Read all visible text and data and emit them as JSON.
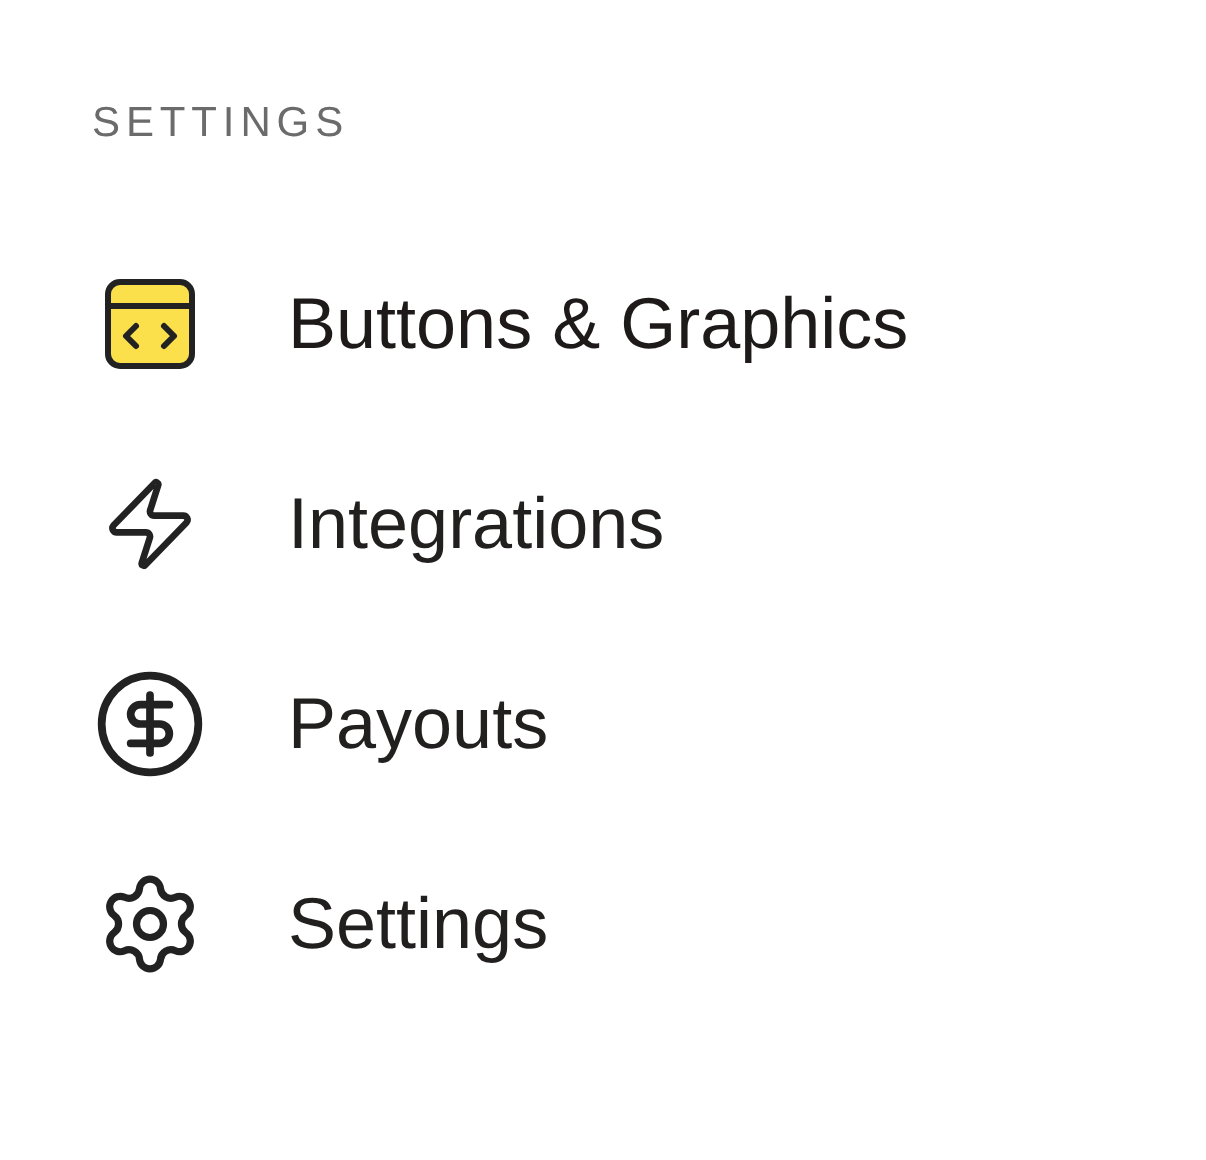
{
  "section_heading": "SETTINGS",
  "items": [
    {
      "kind": "code-window",
      "label": "Buttons & Graphics",
      "selected": true
    },
    {
      "kind": "bolt",
      "label": "Integrations",
      "selected": false
    },
    {
      "kind": "dollar",
      "label": "Payouts",
      "selected": false
    },
    {
      "kind": "gear",
      "label": "Settings",
      "selected": false
    }
  ]
}
